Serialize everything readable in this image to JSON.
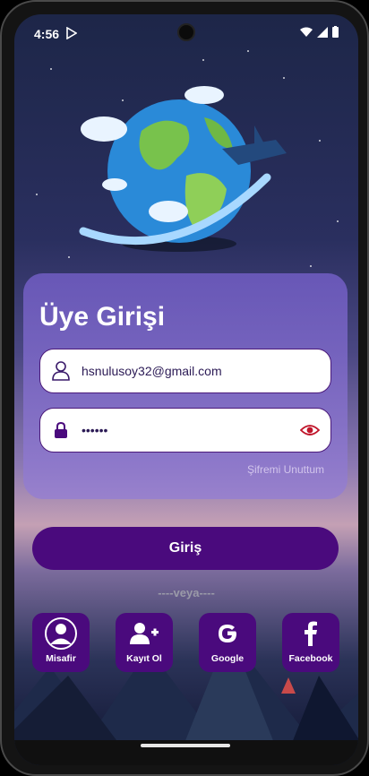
{
  "status_bar": {
    "time": "4:56"
  },
  "login": {
    "title": "Üye Girişi",
    "email_value": "hsnulusoy32@gmail.com",
    "password_masked": "••••••",
    "forgot_label": "Şifremi Unuttum",
    "submit_label": "Giriş"
  },
  "divider": {
    "label": "----veya----"
  },
  "social": [
    {
      "label": "Misafir"
    },
    {
      "label": "Kayıt Ol"
    },
    {
      "label": "Google"
    },
    {
      "label": "Facebook"
    }
  ],
  "colors": {
    "primary": "#4a0a7d",
    "card": "#7a65c8",
    "eye": "#c0152a"
  }
}
